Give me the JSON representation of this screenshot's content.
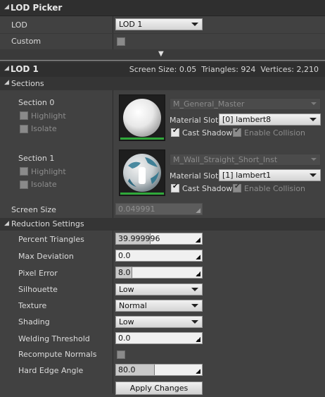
{
  "lod_picker": {
    "title": "LOD Picker",
    "lod_label": "LOD",
    "lod_value": "LOD 1",
    "custom_label": "Custom"
  },
  "lod_panel": {
    "title": "LOD 1",
    "stats": "Screen Size: 0.05  Triangles: 924  Vertices: 2,210"
  },
  "sections": {
    "title": "Sections",
    "items": [
      {
        "label": "Section 0",
        "highlight": "Highlight",
        "isolate": "Isolate",
        "material": "M_General_Master",
        "slot_label": "Material Slot",
        "slot_value": "[0] lambert8",
        "cast_shadow": "Cast Shadow",
        "enable_collision": "Enable Collision"
      },
      {
        "label": "Section 1",
        "highlight": "Highlight",
        "isolate": "Isolate",
        "material": "M_Wall_Straight_Short_Inst",
        "slot_label": "Material Slot",
        "slot_value": "[1] lambert1",
        "cast_shadow": "Cast Shadow",
        "enable_collision": "Enable Collision"
      }
    ]
  },
  "screen_size": {
    "label": "Screen Size",
    "value": "0.049991"
  },
  "reduction": {
    "title": "Reduction Settings",
    "percent_triangles": {
      "label": "Percent Triangles",
      "value": "39.999996",
      "fraction": 0.4
    },
    "max_deviation": {
      "label": "Max Deviation",
      "value": "0.0"
    },
    "pixel_error": {
      "label": "Pixel Error",
      "value": "8.0"
    },
    "silhouette": {
      "label": "Silhouette",
      "value": "Low"
    },
    "texture": {
      "label": "Texture",
      "value": "Normal"
    },
    "shading": {
      "label": "Shading",
      "value": "Low"
    },
    "welding_threshold": {
      "label": "Welding Threshold",
      "value": "0.0"
    },
    "recompute_normals": {
      "label": "Recompute Normals"
    },
    "hard_edge_angle": {
      "label": "Hard Edge Angle",
      "value": "80.0"
    },
    "apply_button": "Apply Changes"
  }
}
